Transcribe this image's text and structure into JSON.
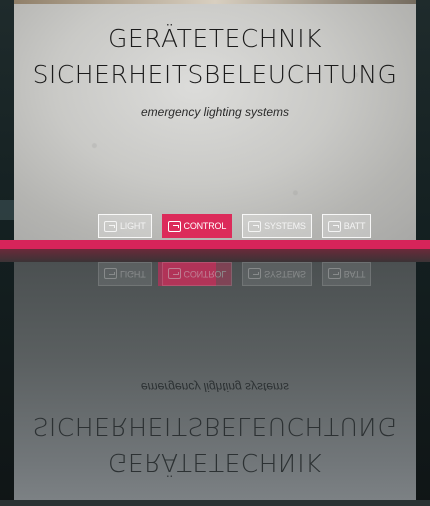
{
  "header": {
    "title_line1": "GERÄTETECHNIK",
    "title_line2": "SICHERHEITSBELEUCHTUNG",
    "subtitle": "emergency lighting systems"
  },
  "nav": {
    "items": [
      {
        "label": "LIGHT",
        "icon": "logo-icon",
        "active": false
      },
      {
        "label": "CONTROL",
        "icon": "logo-icon",
        "active": true
      },
      {
        "label": "SYSTEMS",
        "icon": "logo-icon",
        "active": false
      },
      {
        "label": "BATT",
        "icon": "logo-icon",
        "active": false
      }
    ]
  },
  "colors": {
    "accent": "#d6245a",
    "active_button": "#dc2b5a"
  }
}
